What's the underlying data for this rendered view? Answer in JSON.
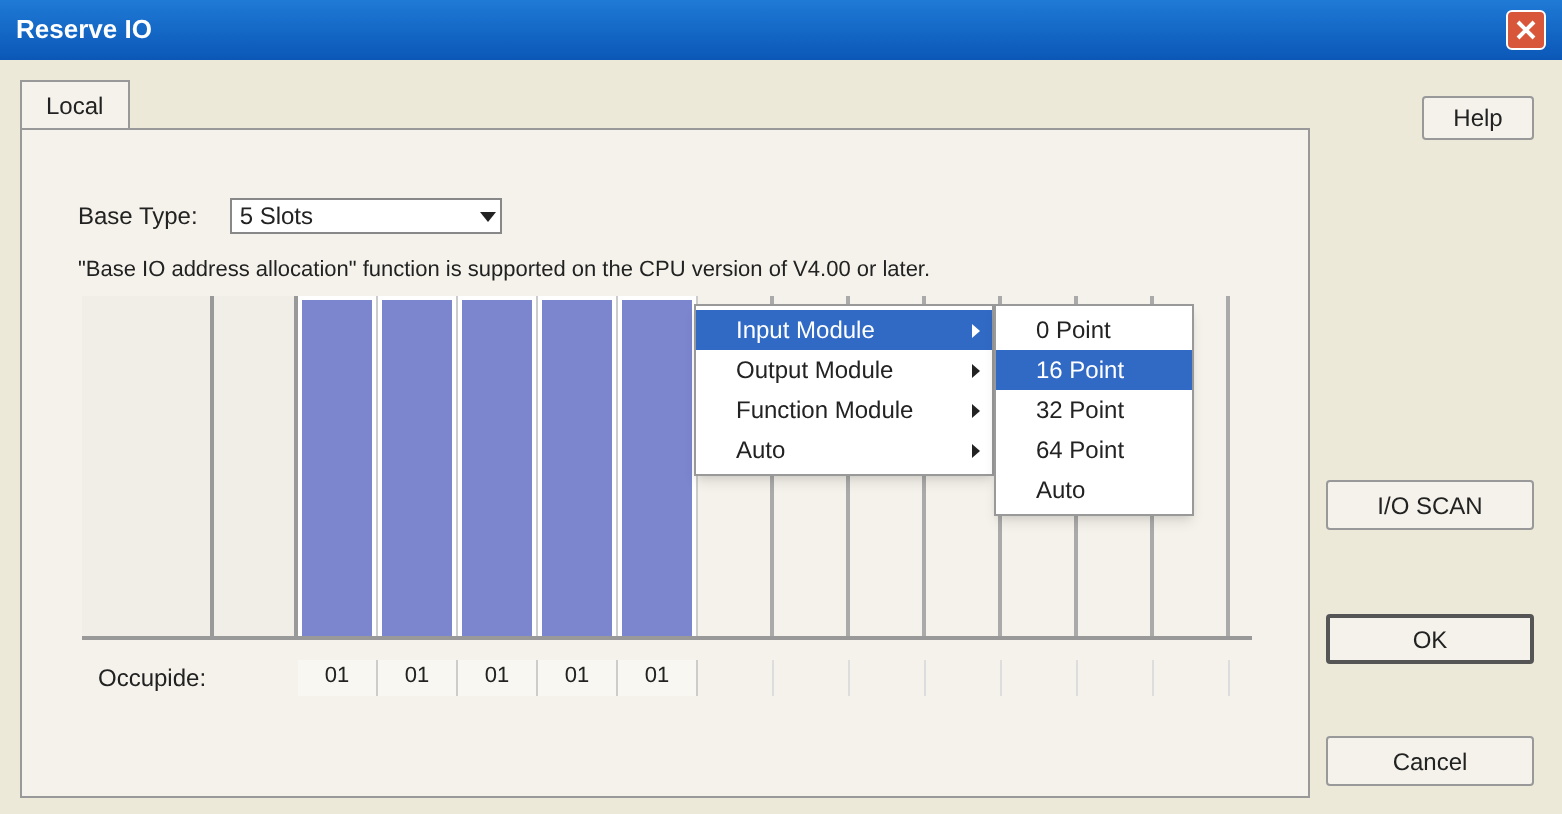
{
  "window": {
    "title": "Reserve IO"
  },
  "tabs": [
    {
      "label": "Local",
      "selected": true
    }
  ],
  "help_button": "Help",
  "base_type": {
    "label": "Base Type:",
    "value": "5 Slots"
  },
  "notice": "\"Base IO address allocation\" function is supported on the CPU version of V4.00 or later.",
  "slots": [
    {
      "assigned": true,
      "occupied": "01"
    },
    {
      "assigned": true,
      "occupied": "01"
    },
    {
      "assigned": true,
      "occupied": "01"
    },
    {
      "assigned": true,
      "occupied": "01"
    },
    {
      "assigned": true,
      "occupied": "01"
    },
    {
      "assigned": false
    },
    {
      "assigned": false
    },
    {
      "assigned": false
    },
    {
      "assigned": false
    },
    {
      "assigned": false
    },
    {
      "assigned": false
    },
    {
      "assigned": false
    }
  ],
  "occupied_label": "Occupide:",
  "context_menu": [
    {
      "label": "Input Module",
      "selected": true
    },
    {
      "label": "Output Module",
      "selected": false
    },
    {
      "label": "Function Module",
      "selected": false
    },
    {
      "label": "Auto",
      "selected": false
    }
  ],
  "submenu": [
    {
      "label": "0 Point",
      "selected": false
    },
    {
      "label": "16 Point",
      "selected": true
    },
    {
      "label": "32 Point",
      "selected": false
    },
    {
      "label": "64 Point",
      "selected": false
    },
    {
      "label": "Auto",
      "selected": false
    }
  ],
  "buttons": [
    {
      "label": "I/O SCAN",
      "default": false
    },
    {
      "label": "OK",
      "default": true
    },
    {
      "label": "Cancel",
      "default": false
    }
  ]
}
